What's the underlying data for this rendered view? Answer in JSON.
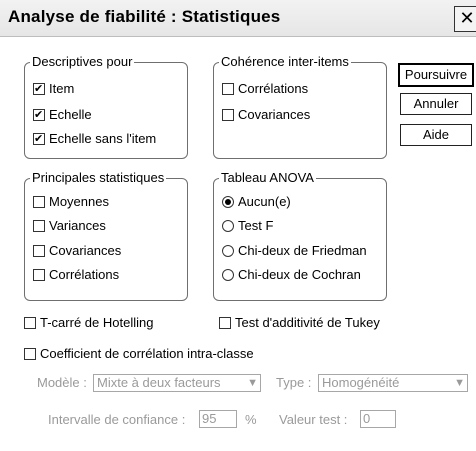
{
  "window": {
    "title": "Analyse de fiabilité : Statistiques",
    "close_glyph": "✕"
  },
  "buttons": {
    "continue": "Poursuivre",
    "cancel": "Annuler",
    "help": "Aide"
  },
  "descriptives": {
    "legend": "Descriptives pour",
    "item": "Item",
    "scale": "Echelle",
    "scale_without_item": "Echelle sans l'item"
  },
  "inter_item": {
    "legend": "Cohérence inter-items",
    "correlations": "Corrélations",
    "covariances": "Covariances"
  },
  "summaries": {
    "legend": "Principales statistiques",
    "means": "Moyennes",
    "variances": "Variances",
    "covariances": "Covariances",
    "correlations": "Corrélations"
  },
  "anova": {
    "legend": "Tableau ANOVA",
    "none": "Aucun(e)",
    "f_test": "Test F",
    "friedman": "Chi-deux de Friedman",
    "cochran": "Chi-deux de Cochran",
    "selected": "none"
  },
  "options": {
    "hotelling": "T-carré de Hotelling",
    "tukey": "Test d'additivité de Tukey",
    "icc": "Coefficient de corrélation intra-classe"
  },
  "icc": {
    "model_label": "Modèle :",
    "model_value": "Mixte à deux facteurs",
    "type_label": "Type :",
    "type_value": "Homogénéité",
    "ci_label": "Intervalle de confiance :",
    "ci_value": "95",
    "percent": "%",
    "test_value_label": "Valeur test :",
    "test_value": "0"
  },
  "colors": {
    "disabled_text": "#9a9a9a",
    "title_bar": "#ececec"
  },
  "icons": {
    "close": "close-icon",
    "dropdown": "chevron-down-icon"
  }
}
